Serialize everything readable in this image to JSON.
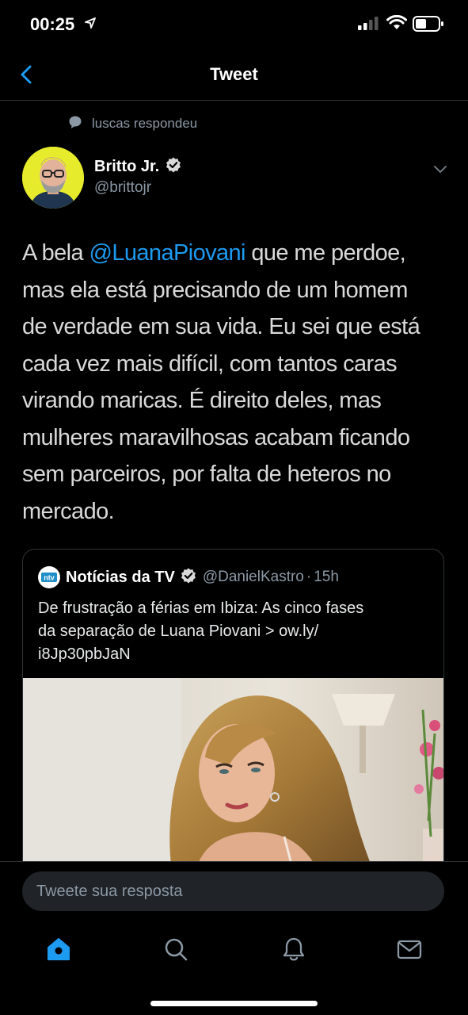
{
  "status_bar": {
    "time": "00:25",
    "icons": [
      "location-arrow-icon",
      "signal-icon",
      "wifi-icon",
      "battery-icon"
    ]
  },
  "nav": {
    "title": "Tweet",
    "back_icon": "chevron-left-icon"
  },
  "reply_context": {
    "icon": "speech-bubble-icon",
    "text": "luscas respondeu"
  },
  "tweet": {
    "author_name": "Britto Jr.",
    "author_handle": "@brittojr",
    "verified": true,
    "text_lines": [
      {
        "before": "A bela ",
        "mention": "@LuanaPiovani",
        "after": " que me perdoe,"
      },
      {
        "text": "mas ela está precisando de um homem"
      },
      {
        "text": "de verdade em sua vida. Eu sei que está"
      },
      {
        "text": "cada vez mais difícil, com tantos caras"
      },
      {
        "text": "virando maricas. É direito deles, mas"
      },
      {
        "text": "mulheres maravilhosas acabam ficando"
      },
      {
        "text": "sem parceiros, por falta de heteros no"
      },
      {
        "text": "mercado."
      }
    ]
  },
  "quoted_tweet": {
    "logo_text": "ntv",
    "name": "Notícias da TV",
    "verified": true,
    "handle": "@DanielKastro",
    "separator": "·",
    "time": "15h",
    "text_lines": [
      "De frustração a férias em Ibiza: As cinco fases",
      "da separação de Luana Piovani > ow.ly/",
      "i8Jp30pbJaN"
    ]
  },
  "composer": {
    "placeholder": "Tweete sua resposta"
  },
  "tab_bar": {
    "items": [
      "home-icon",
      "search-icon",
      "notifications-icon",
      "messages-icon"
    ],
    "active": "home-icon"
  },
  "colors": {
    "background": "#000000",
    "accent": "#1d9bf0",
    "secondary_text": "#8b98a5",
    "primary_text": "#d9d9d9"
  }
}
